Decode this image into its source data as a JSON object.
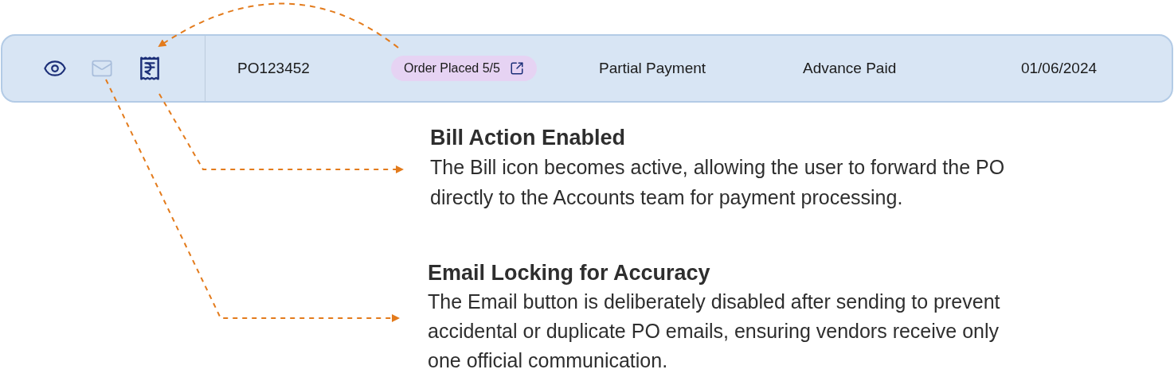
{
  "row": {
    "actions": [
      {
        "kind": "view",
        "disabled": false
      },
      {
        "kind": "email",
        "disabled": true
      },
      {
        "kind": "bill",
        "disabled": false
      }
    ],
    "po_number": "PO123452",
    "status_badge": "Order Placed 5/5",
    "payment_type": "Partial Payment",
    "payment_status": "Advance Paid",
    "date": "01/06/2024"
  },
  "callouts": [
    {
      "title": "Bill Action Enabled",
      "body": "The Bill icon becomes active, allowing the user to forward the PO directly to the Accounts team for payment processing."
    },
    {
      "title": "Email Locking for Accuracy",
      "body": "The Email button is deliberately disabled after sending to prevent accidental or duplicate PO emails, ensuring vendors receive only one official communication."
    }
  ]
}
